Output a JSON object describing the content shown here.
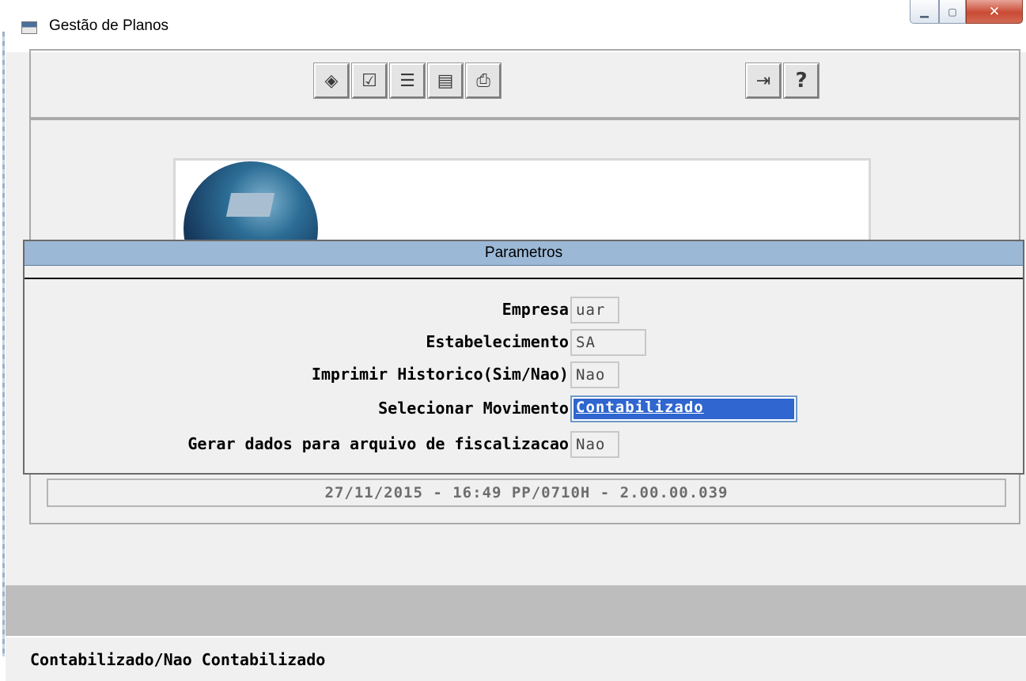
{
  "window": {
    "title": "Gestão de Planos",
    "icon": "window-app-icon",
    "controls": {
      "minimize_icon": "minimize-icon",
      "maximize_icon": "maximize-icon",
      "close_icon": "close-icon"
    }
  },
  "toolbar": {
    "left_buttons": [
      {
        "icon": "execute-icon",
        "glyph": "◈"
      },
      {
        "icon": "checklist-icon",
        "glyph": "☑"
      },
      {
        "icon": "sort-list-icon",
        "glyph": "☰"
      },
      {
        "icon": "selection-list-icon",
        "glyph": "▤"
      },
      {
        "icon": "printer-icon",
        "glyph": "⎙"
      }
    ],
    "right_buttons": [
      {
        "icon": "exit-door-icon",
        "glyph": "⇥"
      },
      {
        "icon": "help-icon",
        "glyph": "?"
      }
    ]
  },
  "status_line": "27/11/2015 - 16:49  PP/0710H - 2.00.00.039",
  "dialog": {
    "title": "Parametros",
    "fields": [
      {
        "label": "Empresa:",
        "value": "uar"
      },
      {
        "label": "Estabelecimento:",
        "value": "SA"
      },
      {
        "label": "Imprimir Historico(Sim/Nao):",
        "value": "Nao"
      },
      {
        "label": "Selecionar Movimento:",
        "value": "Contabilizado"
      },
      {
        "label": "Gerar dados para arquivo de fiscalizacao:",
        "value": "Nao"
      }
    ]
  },
  "footer": {
    "hint": "Contabilizado/Nao Contabilizado"
  },
  "colors": {
    "dialog_title_bg": "#9bb8d6",
    "selection": "#2f66d0",
    "close_button": "#c94a34"
  }
}
